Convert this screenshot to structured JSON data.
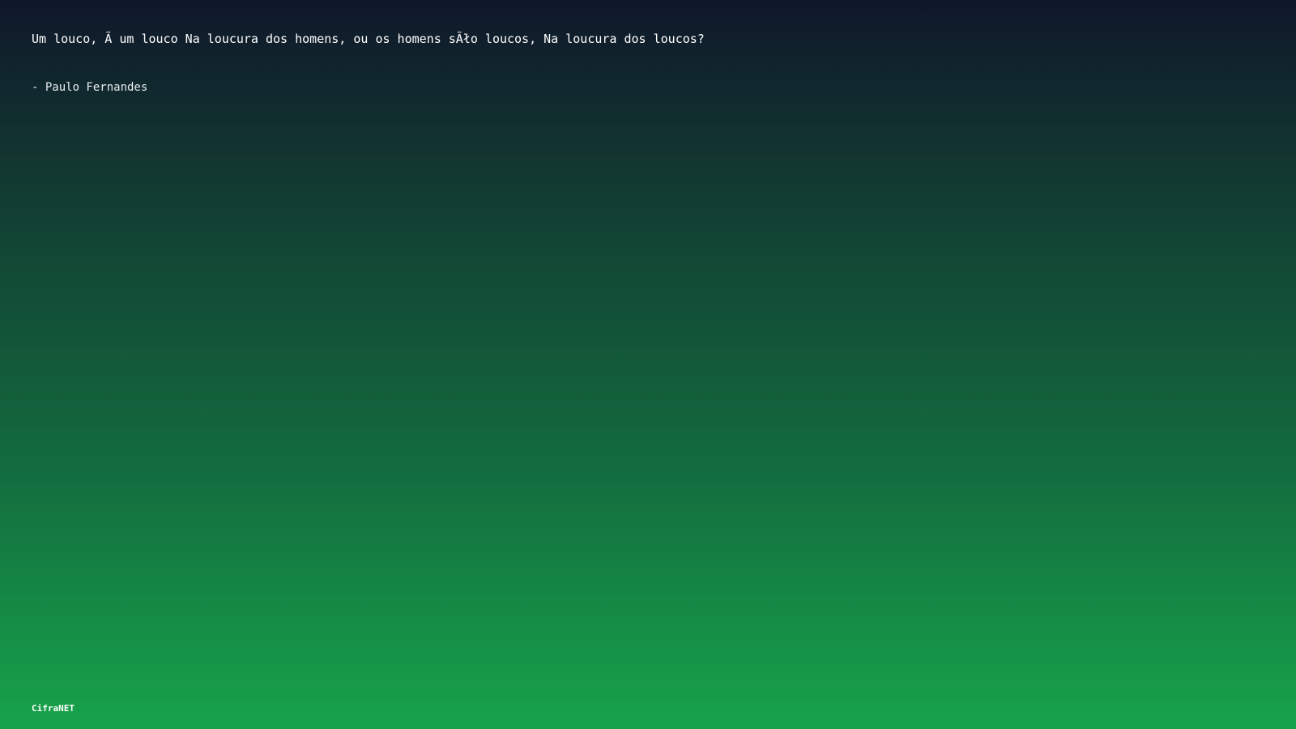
{
  "quote": {
    "text": "Um louco, Ã  um louco Na loucura dos homens, ou os homens sÃło loucos, Na loucura dos loucos?",
    "author": "- Paulo Fernandes"
  },
  "footer": {
    "brand": "CifraNET"
  },
  "colors": {
    "background_top": "#0f172a",
    "background_bottom": "#16a34a",
    "text": "#ffffff"
  }
}
